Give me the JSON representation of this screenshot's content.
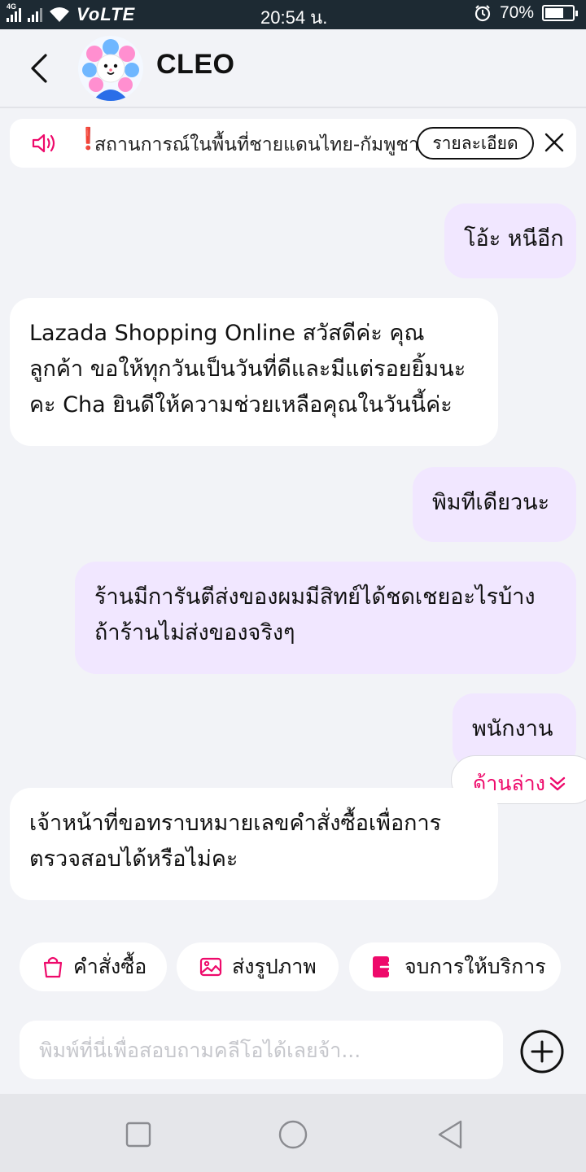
{
  "status_bar": {
    "network": "VoLTE",
    "signal_small": "4G",
    "time": "20:54 น.",
    "battery": "70%",
    "battery_level": 0.7
  },
  "header": {
    "title": "CLEO"
  },
  "notice": {
    "exclamation": "❗",
    "text": "สถานการณ์ในพื้นที่ชายแดนไทย-กัมพูชา",
    "detail_button": "รายละเอียด"
  },
  "messages": [
    {
      "side": "out",
      "text": "โอ้ะ หนีอีก"
    },
    {
      "side": "in",
      "lines": [
        "Lazada Shopping Online สวัสดีค่ะ คุณ",
        "ลูกค้า ขอให้ทุกวันเป็นวันที่ดีและมีแต่รอยยิ้มนะ",
        "คะ Cha ยินดีให้ความช่วยเหลือคุณในวันนี้ค่ะ"
      ]
    },
    {
      "side": "out",
      "text": "พิมทีเดียวนะ"
    },
    {
      "side": "out",
      "lines": [
        "ร้านมีการันตีส่งของผมมีสิทย์ได้ชดเชยอะไรบ้าง",
        "ถ้าร้านไม่ส่งของจริงๆ"
      ]
    },
    {
      "side": "out",
      "text": "พนักงาน"
    },
    {
      "side": "in",
      "lines": [
        "เจ้าหน้าที่ขอทราบหมายเลขคำสั่งซื้อเพื่อการ",
        "ตรวจสอบได้หรือไม่คะ"
      ]
    }
  ],
  "jump_button": "ด้านล่าง",
  "quick_actions": [
    {
      "label": "คำสั่งซื้อ",
      "icon": "shopping-bag-icon"
    },
    {
      "label": "ส่งรูปภาพ",
      "icon": "image-icon"
    },
    {
      "label": "จบการให้บริการ",
      "icon": "exit-icon"
    }
  ],
  "composer": {
    "placeholder": "พิมพ์ที่นี่เพื่อสอบถามคลีโอได้เลยจ้า..."
  },
  "colors": {
    "accent": "#ee0a6b",
    "outgoing_bubble": "#f1e7ff",
    "incoming_bubble": "#ffffff",
    "background": "#f2f3f7"
  }
}
